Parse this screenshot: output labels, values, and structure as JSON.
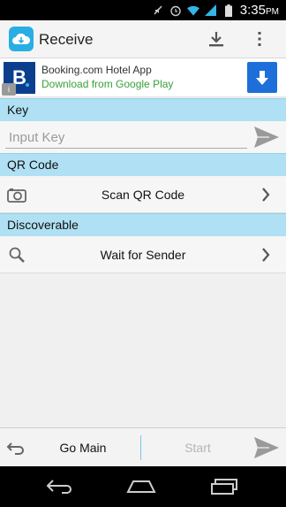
{
  "status_bar": {
    "time": "3:35",
    "ampm": "PM",
    "icons": [
      "mute-icon",
      "alarm-icon",
      "wifi-icon",
      "signal-icon",
      "battery-icon"
    ]
  },
  "app_bar": {
    "title": "Receive",
    "icons": [
      "cloud-app-icon",
      "download-icon",
      "overflow-menu-icon"
    ],
    "brand_color": "#29aee3"
  },
  "ad": {
    "logo_letter": "B",
    "title": "Booking.com Hotel App",
    "subtitle": "Download from Google Play",
    "info_glyph": "i",
    "colors": {
      "logo": "#0b3f8d",
      "subtitle": "#39a13a",
      "download_button": "#1e6fd9"
    }
  },
  "sections": {
    "key": {
      "header": "Key",
      "input_value": "",
      "input_placeholder": "Input Key"
    },
    "qr": {
      "header": "QR Code",
      "row_label": "Scan QR Code",
      "icon": "camera-icon"
    },
    "discoverable": {
      "header": "Discoverable",
      "row_label": "Wait for Sender",
      "icon": "magnifier-icon"
    },
    "header_color": "#b0e0f3"
  },
  "action_bar": {
    "left_label": "Go Main",
    "right_label": "Start",
    "icons": [
      "undo-icon",
      "send-icon"
    ]
  },
  "nav_bar": {
    "icons": [
      "back-icon",
      "home-icon",
      "recent-apps-icon"
    ]
  }
}
